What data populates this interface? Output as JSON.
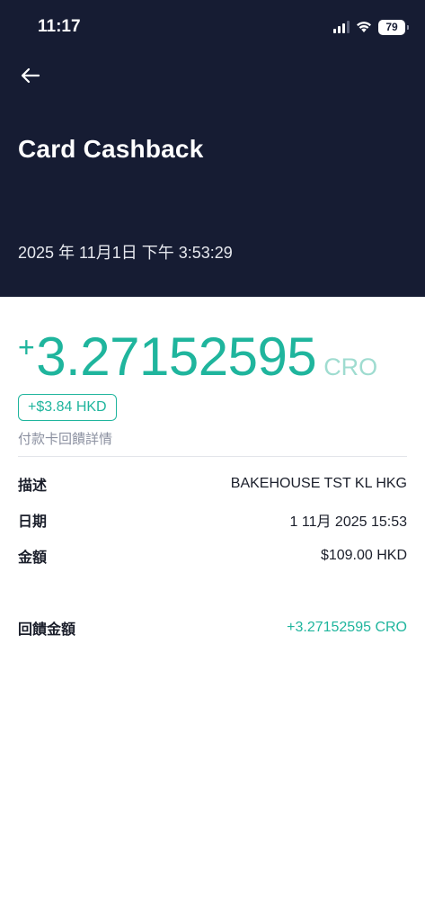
{
  "status_bar": {
    "time": "11:17",
    "battery": "79"
  },
  "header": {
    "title": "Card Cashback",
    "datetime": "2025 年 11月1日 下午 3:53:29"
  },
  "summary": {
    "amount": "3.27152595",
    "unit": "CRO",
    "fiat": "+$3.84 HKD",
    "subtitle": "付款卡回饋詳情"
  },
  "details": [
    {
      "label": "描述",
      "value": "BAKEHOUSE TST KL HKG"
    },
    {
      "label": "日期",
      "value": "1 11月 2025 15:53"
    },
    {
      "label": "金額",
      "value": "$109.00 HKD"
    }
  ],
  "reward": {
    "label": "回饋金額",
    "value": "+3.27152595 CRO"
  },
  "colors": {
    "header_bg": "#161c33",
    "accent": "#1fb59d"
  }
}
